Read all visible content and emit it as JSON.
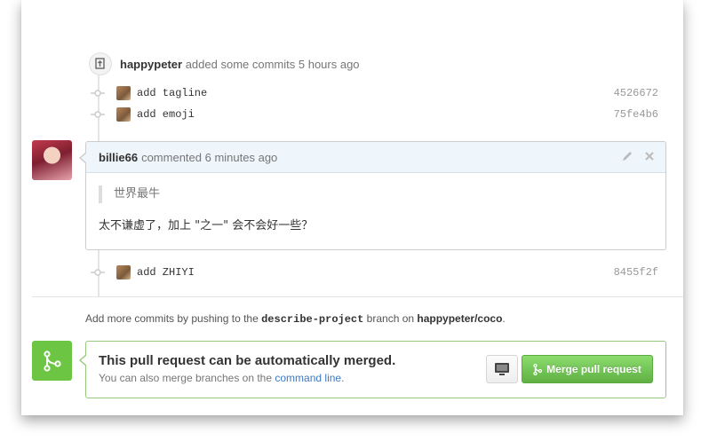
{
  "push_event": {
    "actor": "happypeter",
    "action": "added some commits 5 hours ago"
  },
  "commits_first": [
    {
      "message": "add tagline",
      "sha": "4526672"
    },
    {
      "message": "add emoji",
      "sha": "75fe4b6"
    }
  ],
  "comment": {
    "author": "billie66",
    "meta": "commented 6 minutes ago",
    "quote": "世界最牛",
    "body": "太不谦虚了，加上 \"之一\" 会不会好一些？"
  },
  "commits_second": [
    {
      "message": "add ZHIYI",
      "sha": "8455f2f"
    }
  ],
  "hint": {
    "prefix": "Add more commits by pushing to the",
    "branch": "describe-project",
    "middle": "branch on",
    "repo": "happypeter/coco",
    "suffix": "."
  },
  "merge": {
    "title": "This pull request can be automatically merged.",
    "sub_prefix": "You can also merge branches on the",
    "sub_link": "command line",
    "sub_suffix": ".",
    "button_label": "Merge pull request"
  },
  "colors": {
    "merge_green": "#6cc644",
    "link_blue": "#4078c0",
    "comment_header_bg": "#eef5fb"
  }
}
